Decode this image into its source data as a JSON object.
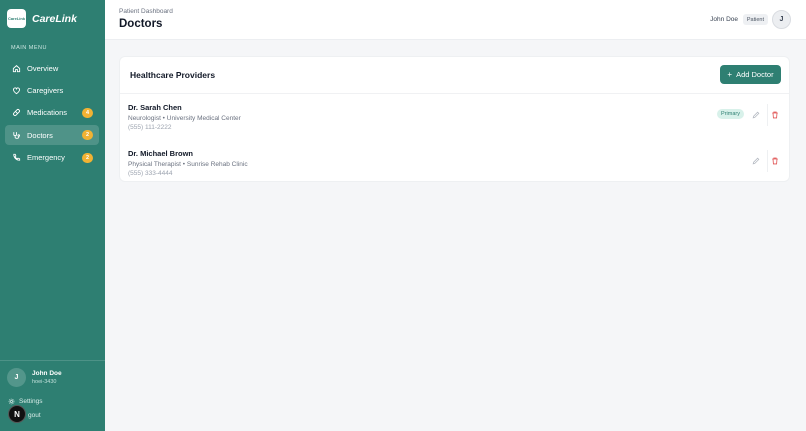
{
  "app": {
    "name": "CareLink",
    "logo_text": "CareLink"
  },
  "sidebar": {
    "section_title": "MAIN MENU",
    "items": [
      {
        "label": "Overview",
        "icon": "home-icon",
        "badge": "",
        "active": false
      },
      {
        "label": "Caregivers",
        "icon": "heart-icon",
        "badge": "",
        "active": false
      },
      {
        "label": "Medications",
        "icon": "pill-icon",
        "badge": "4",
        "active": false
      },
      {
        "label": "Doctors",
        "icon": "stethoscope-icon",
        "badge": "2",
        "active": true
      },
      {
        "label": "Emergency",
        "icon": "phone-icon",
        "badge": "2",
        "active": false
      }
    ],
    "user": {
      "initial": "J",
      "name": "John Doe",
      "id": "hoei-3430"
    },
    "settings_label": "Settings",
    "logout_label": "gout",
    "n_badge": "N"
  },
  "header": {
    "breadcrumb": "Patient Dashboard",
    "title": "Doctors",
    "user_name": "John Doe",
    "role": "Patient",
    "avatar_initial": "J"
  },
  "providers": {
    "title": "Healthcare Providers",
    "add_label": "Add Doctor",
    "doctors": [
      {
        "name": "Dr. Sarah Chen",
        "specialty": "Neurologist • University Medical Center",
        "phone": "(555) 111-2222",
        "badge": "Primary"
      },
      {
        "name": "Dr. Michael Brown",
        "specialty": "Physical Therapist • Sunrise Rehab Clinic",
        "phone": "(555) 333-4444",
        "badge": ""
      }
    ]
  },
  "colors": {
    "accent": "#2e7f72",
    "badge": "#f2b233",
    "delete": "#e05252"
  }
}
